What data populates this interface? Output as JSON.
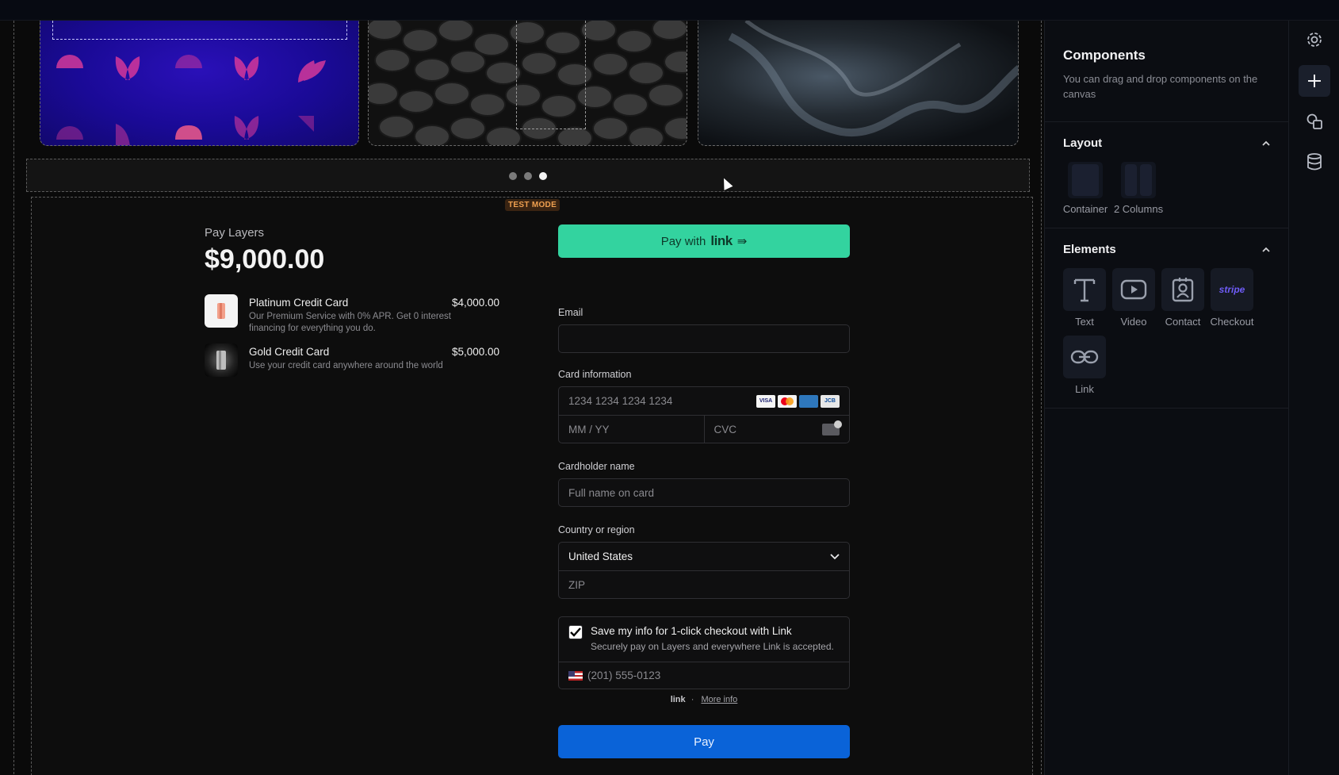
{
  "checkout": {
    "test_mode": "TEST MODE",
    "merchant": "Pay Layers",
    "total": "$9,000.00",
    "items": [
      {
        "name": "Platinum Credit Card",
        "price": "$4,000.00",
        "desc": "Our Premium Service with 0% APR. Get 0 interest financing for everything you do."
      },
      {
        "name": "Gold Credit Card",
        "price": "$5,000.00",
        "desc": "Use your credit card anywhere around the world"
      }
    ],
    "link_button": {
      "prefix": "Pay with",
      "brand": "link",
      "arrow": "⇛"
    },
    "email_label": "Email",
    "email_value": "",
    "card_label": "Card information",
    "card_placeholder": "1234 1234 1234 1234",
    "card_brands": [
      "VISA",
      "MC",
      "AMEX",
      "JCB"
    ],
    "expiry_placeholder": "MM / YY",
    "cvc_placeholder": "CVC",
    "cardholder_label": "Cardholder name",
    "cardholder_placeholder": "Full name on card",
    "country_label": "Country or region",
    "country_value": "United States",
    "zip_placeholder": "ZIP",
    "save_title": "Save my info for 1-click checkout with Link",
    "save_sub": "Securely pay on Layers and everywhere Link is accepted.",
    "phone_placeholder": "(201) 555-0123",
    "link_foot_brand": "link",
    "link_foot_sep": "·",
    "link_foot_more": "More info",
    "pay_label": "Pay"
  },
  "carousel": {
    "active_dot": 3,
    "dot_count": 3
  },
  "panel": {
    "title": "Components",
    "subtitle": "You can drag and drop components on the canvas",
    "layout": {
      "title": "Layout",
      "items": [
        {
          "label": "Container"
        },
        {
          "label": "2 Columns"
        }
      ]
    },
    "elements": {
      "title": "Elements",
      "items": [
        {
          "label": "Text",
          "icon": "text-icon"
        },
        {
          "label": "Video",
          "icon": "video-icon"
        },
        {
          "label": "Contact",
          "icon": "contact-icon"
        },
        {
          "label": "Checkout",
          "icon": "stripe-icon",
          "badge": "stripe"
        },
        {
          "label": "Link",
          "icon": "link-icon"
        }
      ]
    }
  },
  "colors": {
    "link_green": "#33d39f",
    "pay_blue": "#0a63d8",
    "stripe_purple": "#6e5cf6",
    "test_mode_orange": "#f0a050"
  }
}
